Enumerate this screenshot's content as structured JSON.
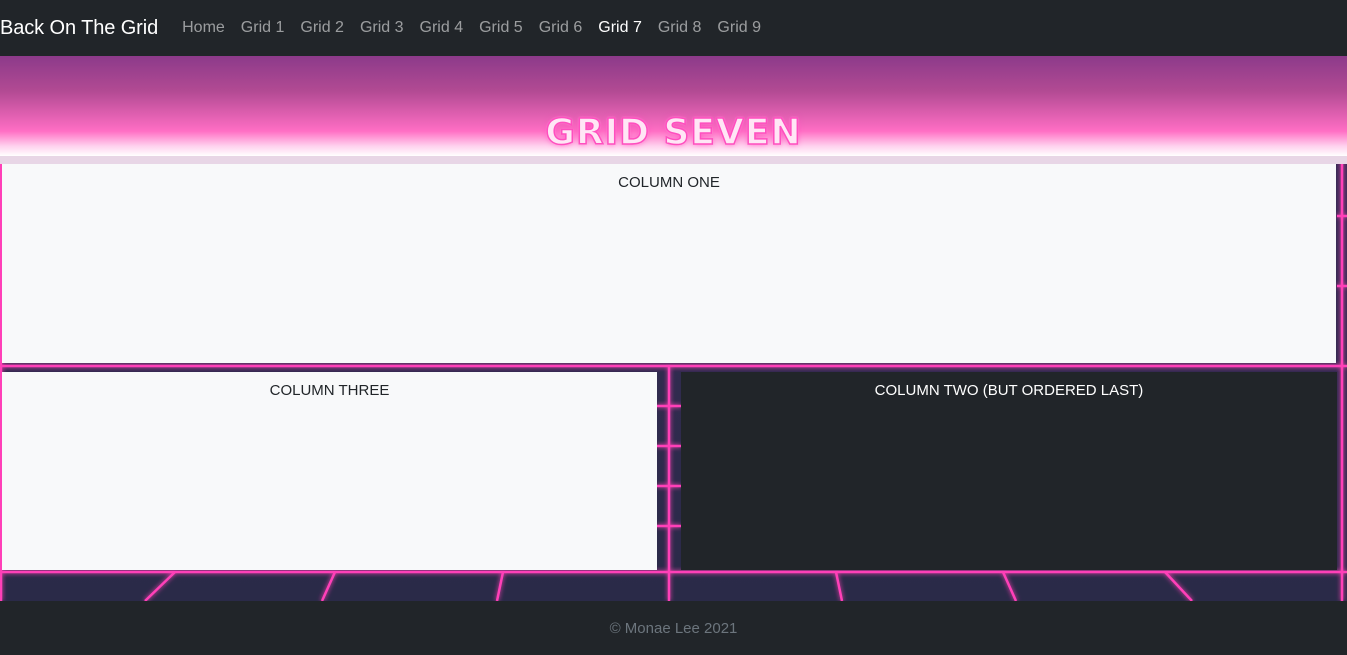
{
  "navbar": {
    "brand": "Back On The Grid",
    "links": [
      "Home",
      "Grid 1",
      "Grid 2",
      "Grid 3",
      "Grid 4",
      "Grid 5",
      "Grid 6",
      "Grid 7",
      "Grid 8",
      "Grid 9"
    ],
    "active_link": "Grid 7"
  },
  "hero": {
    "title": "GRID SEVEN"
  },
  "columns": {
    "one": "COLUMN ONE",
    "three": "COLUMN THREE",
    "two": "COLUMN TWO (BUT ORDERED LAST)"
  },
  "footer": {
    "text": "© Monae Lee 2021"
  },
  "colors": {
    "navbar": "#212529",
    "neon_pink": "#ff4fbf",
    "panel_light": "#f8f9fa",
    "panel_dark": "#212529",
    "grid_background": "#2c2a4a"
  }
}
